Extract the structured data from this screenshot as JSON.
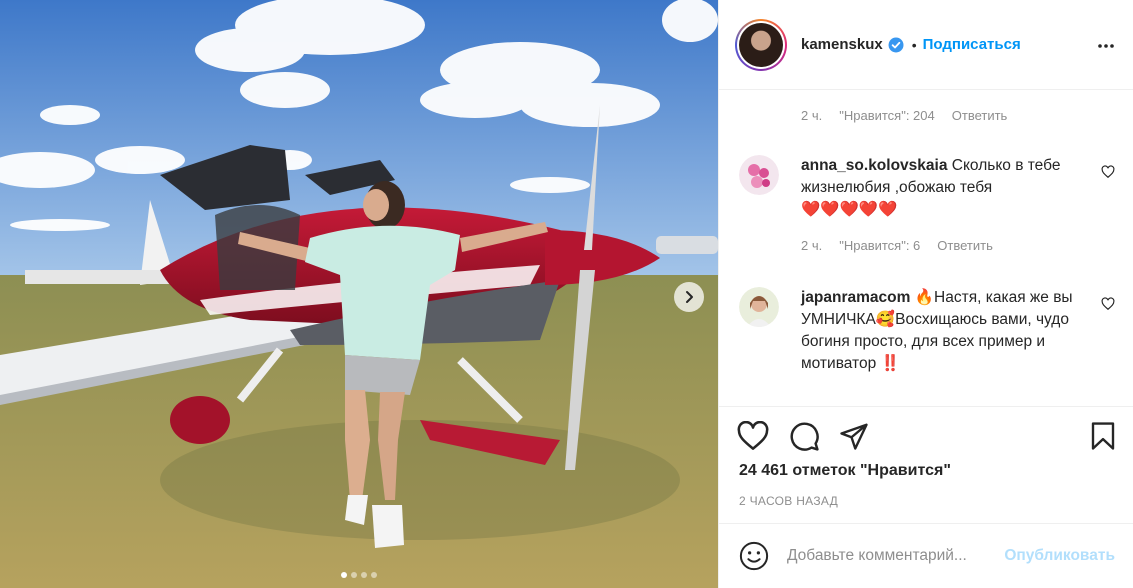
{
  "post": {
    "author": {
      "username": "kamenskux",
      "verified": true,
      "follow_label": "Подписаться",
      "separator": "•"
    },
    "carousel": {
      "slides": 4,
      "active_index": 0
    },
    "previous_comment_meta": {
      "time": "2 ч.",
      "likes": "\"Нравится\": 204",
      "reply": "Ответить"
    },
    "comments": [
      {
        "username": "anna_so.kolovskaia",
        "text": "Сколько в тебе жизнелюбия ,обожаю тебя",
        "emoji": "❤️❤️❤️❤️❤️",
        "time": "2 ч.",
        "likes": "\"Нравится\": 6",
        "reply": "Ответить"
      },
      {
        "username": "japanramacom",
        "text_parts": [
          "🔥",
          "Настя, какая же вы УМНИЧКА",
          "🥰",
          "Восхищаюсь вами, чудо богиня просто, для всех пример и мотиватор",
          "‼️"
        ]
      }
    ],
    "likes_count": "24 461 отметок \"Нравится\"",
    "timestamp": "2 ЧАСОВ НАЗАД",
    "comment_input": {
      "placeholder": "Добавьте комментарий...",
      "value": ""
    },
    "publish_label": "Опубликовать",
    "icons": [
      "more-icon",
      "heart-icon",
      "comment-icon",
      "share-icon",
      "bookmark-icon",
      "emoji-icon",
      "verified-icon",
      "chevron-right-icon"
    ],
    "colors": {
      "accent": "#0095f6",
      "publish_disabled": "#b2dffc",
      "muted": "#8e8e8e",
      "like_red": "#ed4956"
    }
  }
}
